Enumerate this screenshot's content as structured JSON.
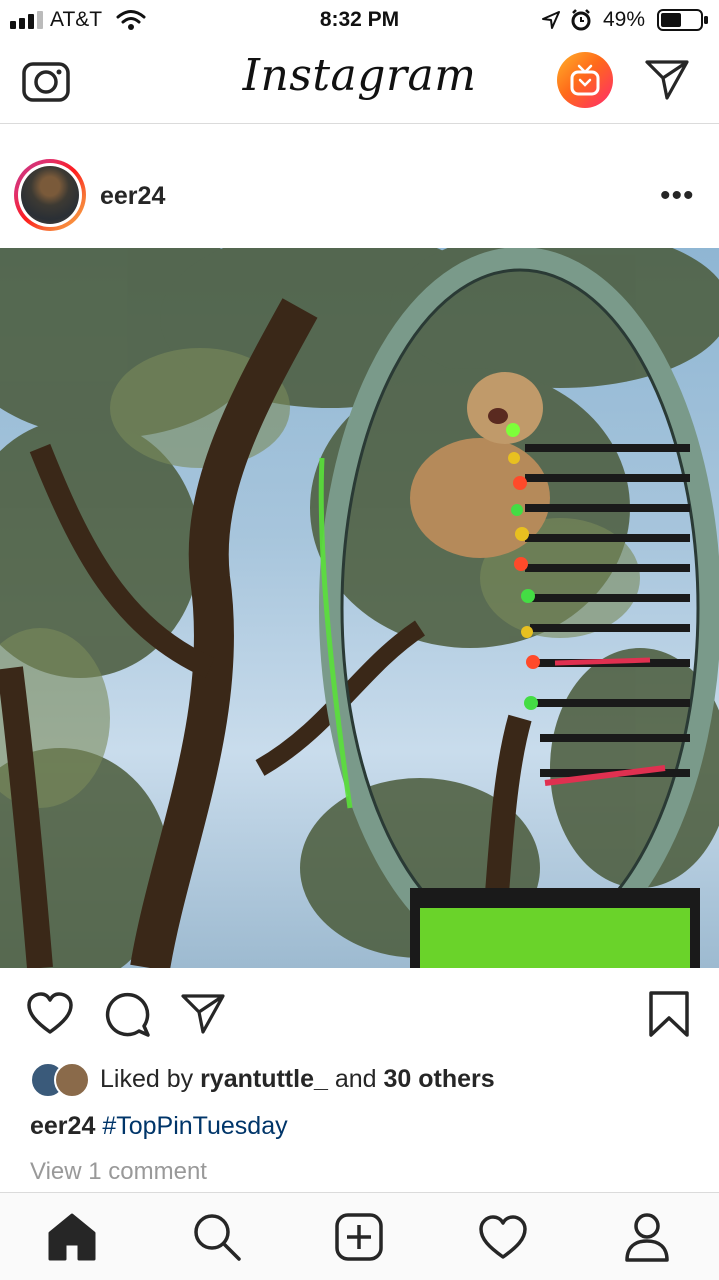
{
  "status_bar": {
    "carrier": "AT&T",
    "time": "8:32 PM",
    "battery": "49%"
  },
  "top_nav": {
    "logo": "Instagram",
    "camera_icon": "camera-icon",
    "igtv_icon": "igtv-icon",
    "direct_icon": "paper-plane-icon"
  },
  "post": {
    "username": "eer24",
    "more_label": "•••",
    "likes": {
      "prefix": "Liked by ",
      "user": "ryantuttle_",
      "middle": " and ",
      "others": "30 others"
    },
    "caption": {
      "user": "eer24",
      "hashtag": "#TopPinTuesday"
    },
    "comments_link": "View 1 comment"
  },
  "tab_bar": {
    "items": [
      "home-icon",
      "search-icon",
      "new-post-icon",
      "activity-icon",
      "profile-icon"
    ]
  },
  "colors": {
    "hashtag": "#003569",
    "igtv_gradient_start": "#ffb22a",
    "igtv_gradient_end": "#ff2a6d"
  }
}
